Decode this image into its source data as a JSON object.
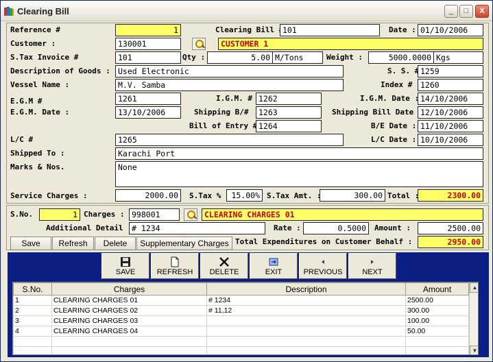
{
  "window": {
    "title": "Clearing Bill",
    "min_label": "_",
    "max_label": "□",
    "close_label": "X"
  },
  "labels": {
    "reference": "Reference #",
    "clearing_bill": "Clearing Bill #",
    "date": "Date :",
    "customer": "Customer :",
    "stax_invoice": "S.Tax Invoice #",
    "qty": "Qty :",
    "weight": "Weight :",
    "description_goods": "Description of Goods :",
    "ss": "S. S. #",
    "vessel": "Vessel Name :",
    "index": "Index #",
    "egm": "E.G.M #",
    "igm": "I.G.M. #",
    "igm_date": "I.G.M. Date :",
    "egm_date": "E.G.M. Date :",
    "shipping_b": "Shipping B/#",
    "shipping_bill_date": "Shipping Bill Date :",
    "bill_of_entry": "Bill of Entry #",
    "be_date": "B/E Date :",
    "lc": "L/C #",
    "lc_date": "L/C Date :",
    "shipped_to": "Shipped To :",
    "marks": "Marks & Nos.",
    "service_charges": "Service Charges :",
    "stax_pct": "S.Tax %",
    "stax_amt": "S.Tax Amt. :",
    "total": "Total :",
    "sno": "S.No. :",
    "charges": "Charges :",
    "additional": "Additional Detail :",
    "rate": "Rate :",
    "amount": "Amount :",
    "total_exp": "Total Expenditures on Customer Behalf :"
  },
  "fields": {
    "reference": "1",
    "clearing_bill": "101",
    "date": "01/10/2006",
    "customer_code": "130001",
    "customer_name": "CUSTOMER 1",
    "stax_invoice": "101",
    "qty": "5.00",
    "qty_unit": "M/Tons",
    "weight": "5000.0000",
    "weight_unit": "Kgs",
    "description_goods": "Used Electronic",
    "ss": "1259",
    "vessel": "M.V. Samba",
    "index": "1260",
    "egm": "1261",
    "igm": "1262",
    "igm_date": "14/10/2006",
    "egm_date": "13/10/2006",
    "shipping_b": "1263",
    "shipping_bill_date": "12/10/2006",
    "bill_of_entry": "1264",
    "be_date": "11/10/2006",
    "lc": "1265",
    "lc_date": "10/10/2006",
    "shipped_to": "Karachi Port",
    "marks": "None",
    "service_charges": "2000.00",
    "stax_pct": "15.00%",
    "stax_amt": "300.00",
    "total": "2300.00",
    "sno": "1",
    "charges_code": "998001",
    "charges_name": "CLEARING CHARGES 01",
    "additional": "# 1234",
    "rate": "0.5000",
    "amount": "2500.00",
    "total_exp": "2950.00"
  },
  "detail_buttons": {
    "save": "Save",
    "refresh": "Refresh",
    "delete": "Delete",
    "supplementary": "Supplementary Charges"
  },
  "toolbar": {
    "save": "SAVE",
    "refresh": "REFRESH",
    "delete": "DELETE",
    "exit": "EXIT",
    "previous": "PREVIOUS",
    "next": "NEXT"
  },
  "grid": {
    "headers": [
      "S.No.",
      "Charges",
      "Description",
      "Amount"
    ],
    "rows": [
      [
        "1",
        "CLEARING CHARGES 01",
        "# 1234",
        "2500.00"
      ],
      [
        "2",
        "CLEARING CHARGES 02",
        "# 11,12",
        "300.00"
      ],
      [
        "3",
        "CLEARING CHARGES 03",
        "",
        "100.00"
      ],
      [
        "4",
        "CLEARING CHARGES 04",
        "",
        "50.00"
      ]
    ],
    "scroll_up": "▲",
    "scroll_down": "▼"
  },
  "colors": {
    "toolbar_bg": "#0B1F84",
    "highlight_field": "#FFFF66",
    "emphasis_text": "#CC0000"
  }
}
